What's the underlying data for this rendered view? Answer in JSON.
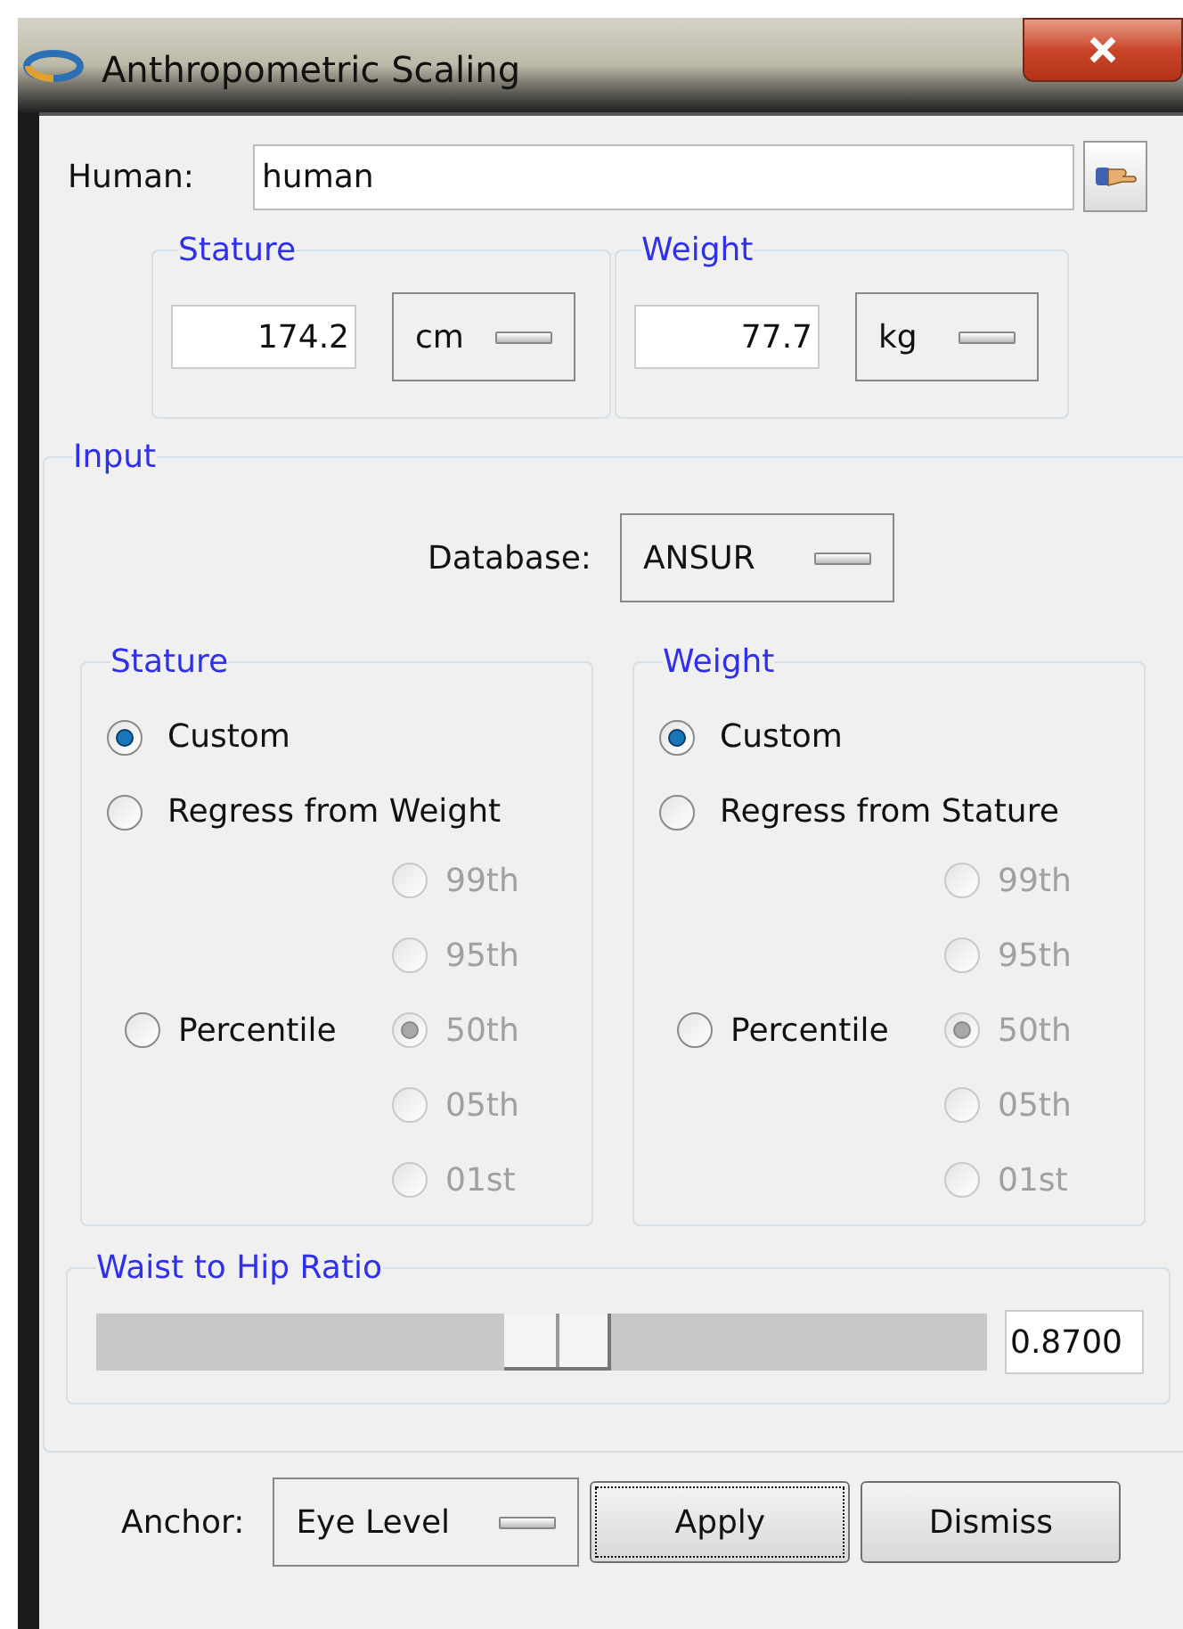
{
  "window": {
    "title": "Anthropometric Scaling"
  },
  "human": {
    "label": "Human:",
    "value": "human"
  },
  "measures": [
    {
      "title": "Stature",
      "value": "174.2",
      "unit": "cm"
    },
    {
      "title": "Weight",
      "value": "77.7",
      "unit": "kg"
    }
  ],
  "input": {
    "title": "Input",
    "database": {
      "label": "Database:",
      "value": "ANSUR"
    },
    "panels": [
      {
        "title": "Stature",
        "options": [
          {
            "label": "Custom",
            "selected": true
          },
          {
            "label": "Regress from Weight",
            "selected": false
          }
        ],
        "percentile": {
          "label": "Percentile",
          "selected": false,
          "values": [
            {
              "label": "99th",
              "selected": false,
              "disabled": true
            },
            {
              "label": "95th",
              "selected": false,
              "disabled": true
            },
            {
              "label": "50th",
              "selected": true,
              "disabled": true
            },
            {
              "label": "05th",
              "selected": false,
              "disabled": true
            },
            {
              "label": "01st",
              "selected": false,
              "disabled": true
            }
          ]
        }
      },
      {
        "title": "Weight",
        "options": [
          {
            "label": "Custom",
            "selected": true
          },
          {
            "label": "Regress from Stature",
            "selected": false
          }
        ],
        "percentile": {
          "label": "Percentile",
          "selected": false,
          "values": [
            {
              "label": "99th",
              "selected": false,
              "disabled": true
            },
            {
              "label": "95th",
              "selected": false,
              "disabled": true
            },
            {
              "label": "50th",
              "selected": true,
              "disabled": true
            },
            {
              "label": "05th",
              "selected": false,
              "disabled": true
            },
            {
              "label": "01st",
              "selected": false,
              "disabled": true
            }
          ]
        }
      }
    ],
    "waist": {
      "title": "Waist to Hip Ratio",
      "level": 0.52,
      "value": "0.8700"
    }
  },
  "footer": {
    "anchor_label": "Anchor:",
    "anchor_value": "Eye Level",
    "buttons": [
      "Apply",
      "Dismiss"
    ]
  }
}
